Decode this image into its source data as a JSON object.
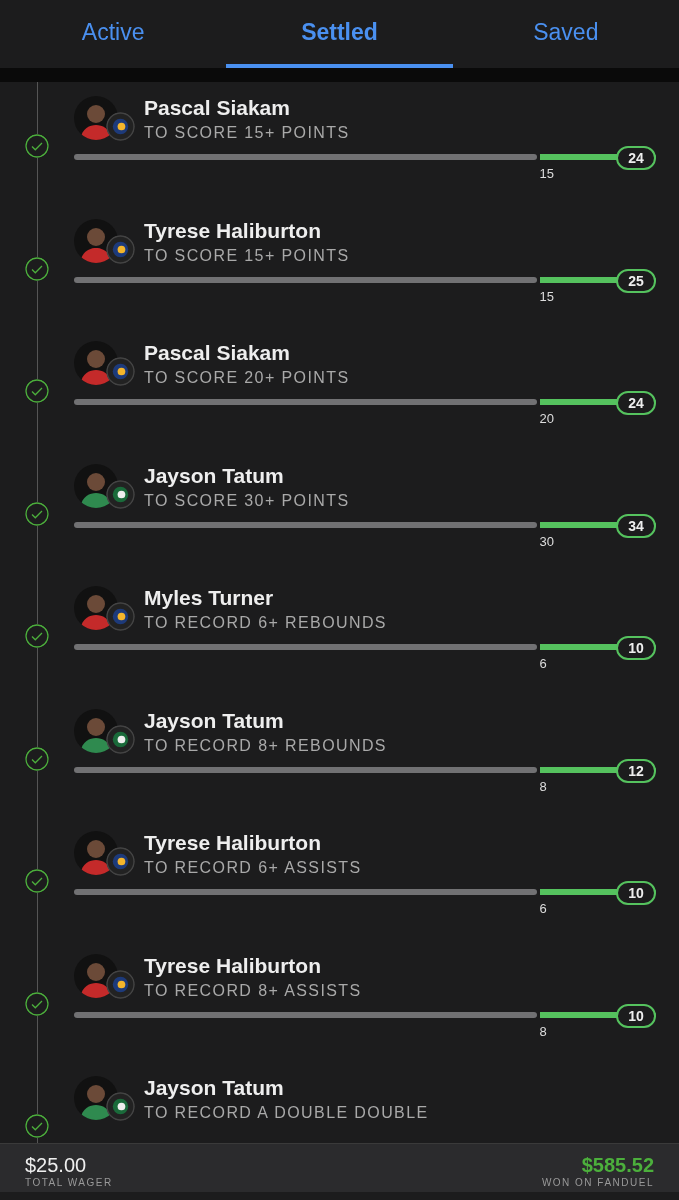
{
  "tabs": [
    {
      "label": "Active",
      "selected": false
    },
    {
      "label": "Settled",
      "selected": true
    },
    {
      "label": "Saved",
      "selected": false
    }
  ],
  "legs": [
    {
      "player": "Pascal Siakam",
      "kind": "pacers",
      "market": "TO SCORE 15+ POINTS",
      "settled": true,
      "line": "15",
      "result": "24"
    },
    {
      "player": "Tyrese Haliburton",
      "kind": "pacers",
      "market": "TO SCORE 15+ POINTS",
      "settled": true,
      "line": "15",
      "result": "25"
    },
    {
      "player": "Pascal Siakam",
      "kind": "pacers",
      "market": "TO SCORE 20+ POINTS",
      "settled": true,
      "line": "20",
      "result": "24"
    },
    {
      "player": "Jayson Tatum",
      "kind": "celtics",
      "market": "TO SCORE 30+ POINTS",
      "settled": true,
      "line": "30",
      "result": "34"
    },
    {
      "player": "Myles Turner",
      "kind": "pacers",
      "market": "TO RECORD 6+ REBOUNDS",
      "settled": true,
      "line": "6",
      "result": "10"
    },
    {
      "player": "Jayson Tatum",
      "kind": "celtics",
      "market": "TO RECORD 8+ REBOUNDS",
      "settled": true,
      "line": "8",
      "result": "12"
    },
    {
      "player": "Tyrese Haliburton",
      "kind": "pacers",
      "market": "TO RECORD 6+ ASSISTS",
      "settled": true,
      "line": "6",
      "result": "10"
    },
    {
      "player": "Tyrese Haliburton",
      "kind": "pacers",
      "market": "TO RECORD 8+ ASSISTS",
      "settled": true,
      "line": "8",
      "result": "10"
    },
    {
      "player": "Jayson Tatum",
      "kind": "celtics",
      "market": "TO RECORD A DOUBLE DOUBLE",
      "settled": true
    }
  ],
  "footer": {
    "wager": "$25.00",
    "wager_label": "TOTAL WAGER",
    "won": "$585.52",
    "won_label": "WON ON FANDUEL"
  }
}
